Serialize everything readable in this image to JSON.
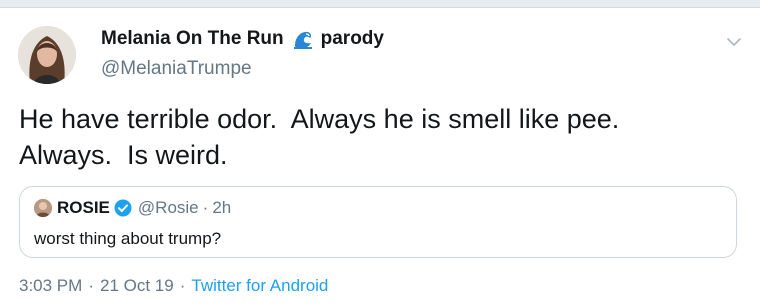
{
  "tweet": {
    "author": {
      "display_name": "Melania On The Run",
      "name_emoji": "wave-emoji",
      "name_suffix": "parody",
      "handle": "@MelaniaTrumpe"
    },
    "text_lines": [
      "He have terrible odor.  Always he is smell like pee.",
      "Always.  Is weird."
    ],
    "quoted_tweet": {
      "name": "ROSIE",
      "verified": true,
      "handle": "@Rosie",
      "separator": "·",
      "time": "2h",
      "text": "worst thing about trump?"
    },
    "meta": {
      "time": "3:03 PM",
      "separator_1": "·",
      "date": "21 Oct 19",
      "separator_2": "·",
      "source": "Twitter for Android"
    }
  },
  "icons": {
    "caret": "chevron-down-icon",
    "verified": "verified-badge-icon"
  },
  "colors": {
    "text": "#14171a",
    "secondary": "#657786",
    "link": "#1da1f2",
    "border": "#ccd6dd",
    "verified": "#1da1f2"
  }
}
